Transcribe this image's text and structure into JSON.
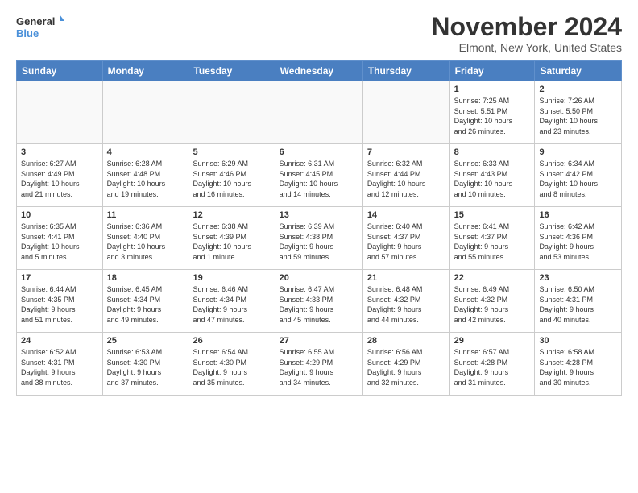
{
  "header": {
    "logo_line1": "General",
    "logo_line2": "Blue",
    "month_title": "November 2024",
    "location": "Elmont, New York, United States"
  },
  "weekdays": [
    "Sunday",
    "Monday",
    "Tuesday",
    "Wednesday",
    "Thursday",
    "Friday",
    "Saturday"
  ],
  "weeks": [
    [
      {
        "day": "",
        "info": ""
      },
      {
        "day": "",
        "info": ""
      },
      {
        "day": "",
        "info": ""
      },
      {
        "day": "",
        "info": ""
      },
      {
        "day": "",
        "info": ""
      },
      {
        "day": "1",
        "info": "Sunrise: 7:25 AM\nSunset: 5:51 PM\nDaylight: 10 hours\nand 26 minutes."
      },
      {
        "day": "2",
        "info": "Sunrise: 7:26 AM\nSunset: 5:50 PM\nDaylight: 10 hours\nand 23 minutes."
      }
    ],
    [
      {
        "day": "3",
        "info": "Sunrise: 6:27 AM\nSunset: 4:49 PM\nDaylight: 10 hours\nand 21 minutes."
      },
      {
        "day": "4",
        "info": "Sunrise: 6:28 AM\nSunset: 4:48 PM\nDaylight: 10 hours\nand 19 minutes."
      },
      {
        "day": "5",
        "info": "Sunrise: 6:29 AM\nSunset: 4:46 PM\nDaylight: 10 hours\nand 16 minutes."
      },
      {
        "day": "6",
        "info": "Sunrise: 6:31 AM\nSunset: 4:45 PM\nDaylight: 10 hours\nand 14 minutes."
      },
      {
        "day": "7",
        "info": "Sunrise: 6:32 AM\nSunset: 4:44 PM\nDaylight: 10 hours\nand 12 minutes."
      },
      {
        "day": "8",
        "info": "Sunrise: 6:33 AM\nSunset: 4:43 PM\nDaylight: 10 hours\nand 10 minutes."
      },
      {
        "day": "9",
        "info": "Sunrise: 6:34 AM\nSunset: 4:42 PM\nDaylight: 10 hours\nand 8 minutes."
      }
    ],
    [
      {
        "day": "10",
        "info": "Sunrise: 6:35 AM\nSunset: 4:41 PM\nDaylight: 10 hours\nand 5 minutes."
      },
      {
        "day": "11",
        "info": "Sunrise: 6:36 AM\nSunset: 4:40 PM\nDaylight: 10 hours\nand 3 minutes."
      },
      {
        "day": "12",
        "info": "Sunrise: 6:38 AM\nSunset: 4:39 PM\nDaylight: 10 hours\nand 1 minute."
      },
      {
        "day": "13",
        "info": "Sunrise: 6:39 AM\nSunset: 4:38 PM\nDaylight: 9 hours\nand 59 minutes."
      },
      {
        "day": "14",
        "info": "Sunrise: 6:40 AM\nSunset: 4:37 PM\nDaylight: 9 hours\nand 57 minutes."
      },
      {
        "day": "15",
        "info": "Sunrise: 6:41 AM\nSunset: 4:37 PM\nDaylight: 9 hours\nand 55 minutes."
      },
      {
        "day": "16",
        "info": "Sunrise: 6:42 AM\nSunset: 4:36 PM\nDaylight: 9 hours\nand 53 minutes."
      }
    ],
    [
      {
        "day": "17",
        "info": "Sunrise: 6:44 AM\nSunset: 4:35 PM\nDaylight: 9 hours\nand 51 minutes."
      },
      {
        "day": "18",
        "info": "Sunrise: 6:45 AM\nSunset: 4:34 PM\nDaylight: 9 hours\nand 49 minutes."
      },
      {
        "day": "19",
        "info": "Sunrise: 6:46 AM\nSunset: 4:34 PM\nDaylight: 9 hours\nand 47 minutes."
      },
      {
        "day": "20",
        "info": "Sunrise: 6:47 AM\nSunset: 4:33 PM\nDaylight: 9 hours\nand 45 minutes."
      },
      {
        "day": "21",
        "info": "Sunrise: 6:48 AM\nSunset: 4:32 PM\nDaylight: 9 hours\nand 44 minutes."
      },
      {
        "day": "22",
        "info": "Sunrise: 6:49 AM\nSunset: 4:32 PM\nDaylight: 9 hours\nand 42 minutes."
      },
      {
        "day": "23",
        "info": "Sunrise: 6:50 AM\nSunset: 4:31 PM\nDaylight: 9 hours\nand 40 minutes."
      }
    ],
    [
      {
        "day": "24",
        "info": "Sunrise: 6:52 AM\nSunset: 4:31 PM\nDaylight: 9 hours\nand 38 minutes."
      },
      {
        "day": "25",
        "info": "Sunrise: 6:53 AM\nSunset: 4:30 PM\nDaylight: 9 hours\nand 37 minutes."
      },
      {
        "day": "26",
        "info": "Sunrise: 6:54 AM\nSunset: 4:30 PM\nDaylight: 9 hours\nand 35 minutes."
      },
      {
        "day": "27",
        "info": "Sunrise: 6:55 AM\nSunset: 4:29 PM\nDaylight: 9 hours\nand 34 minutes."
      },
      {
        "day": "28",
        "info": "Sunrise: 6:56 AM\nSunset: 4:29 PM\nDaylight: 9 hours\nand 32 minutes."
      },
      {
        "day": "29",
        "info": "Sunrise: 6:57 AM\nSunset: 4:28 PM\nDaylight: 9 hours\nand 31 minutes."
      },
      {
        "day": "30",
        "info": "Sunrise: 6:58 AM\nSunset: 4:28 PM\nDaylight: 9 hours\nand 30 minutes."
      }
    ]
  ]
}
